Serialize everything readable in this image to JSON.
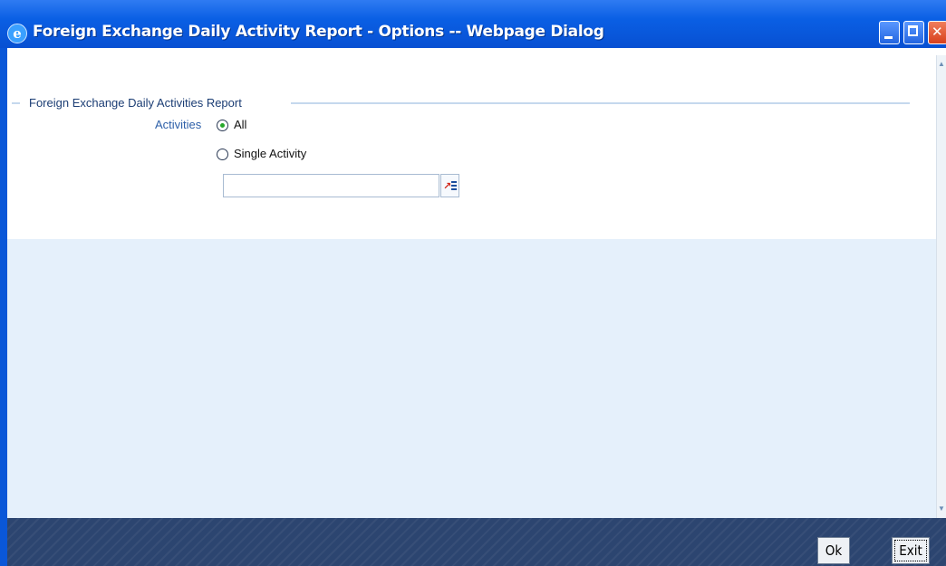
{
  "window": {
    "title": "Foreign Exchange Daily Activity Report - Options -- Webpage Dialog",
    "icon": "ie-icon",
    "title_color": "#ffffff",
    "titlebar_color": "#0a5fe4"
  },
  "form": {
    "section_title": "Foreign Exchange Daily Activities Report",
    "activities_label": "Activities",
    "options": [
      {
        "label": "All",
        "checked": true
      },
      {
        "label": "Single Activity",
        "checked": false
      }
    ],
    "single_activity_value": ""
  },
  "footer": {
    "ok_label": "Ok",
    "exit_label": "Exit"
  }
}
